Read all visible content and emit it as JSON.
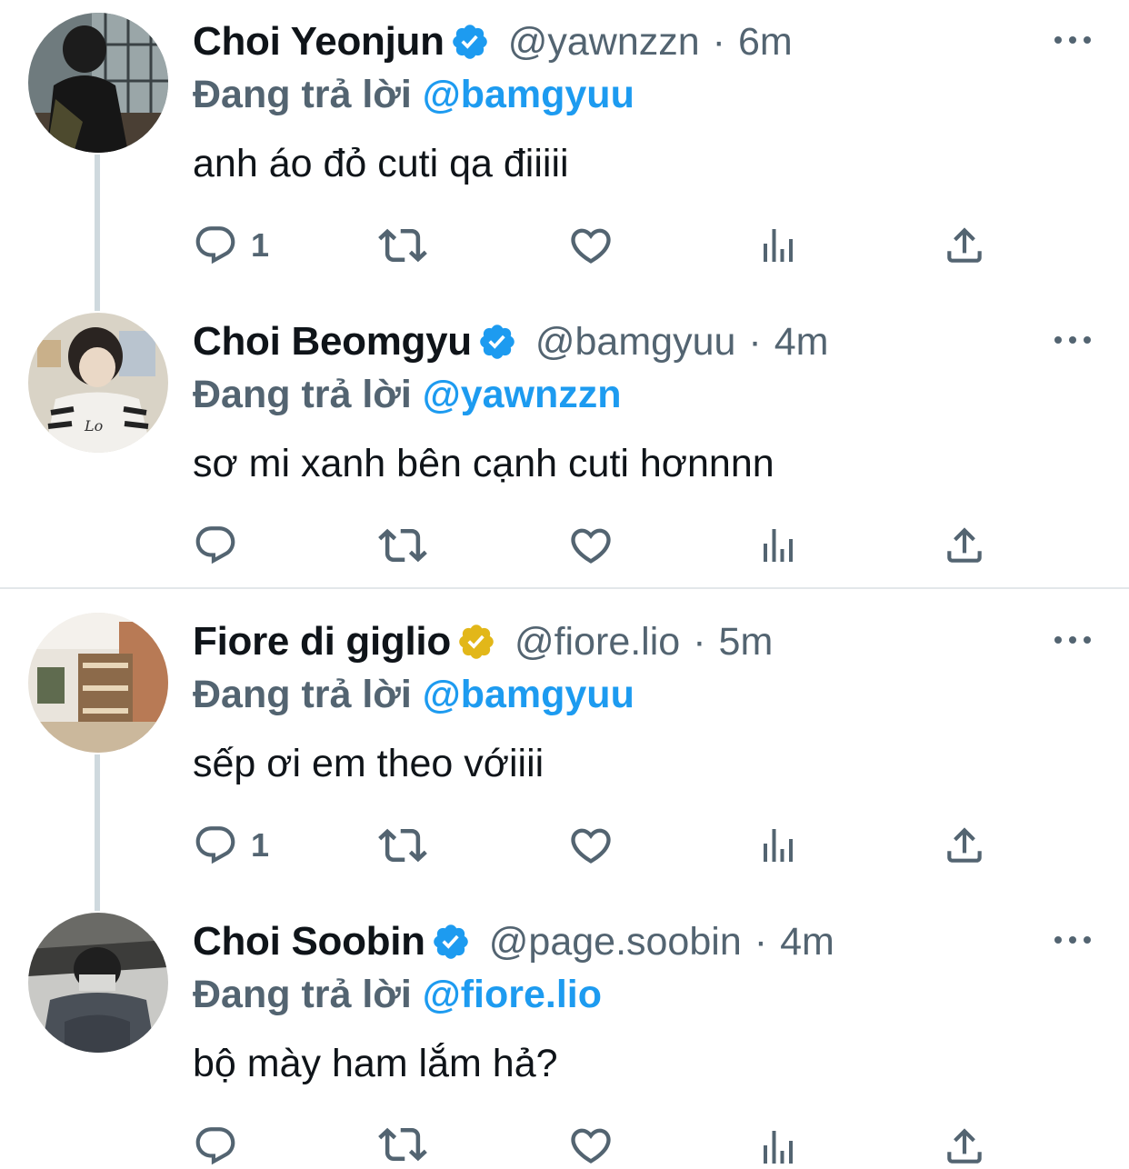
{
  "replying_label": "Đang trả lời",
  "tweets": [
    {
      "name": "Choi Yeonjun",
      "verified_color": "#1d9bf0",
      "handle": "@yawnzzn",
      "separator": "·",
      "time": "6m",
      "replying_to": "@bamgyuu",
      "text": "anh áo đỏ cuti qa điiiii",
      "reply_count": "1"
    },
    {
      "name": "Choi Beomgyu",
      "verified_color": "#1d9bf0",
      "handle": "@bamgyuu",
      "separator": "·",
      "time": "4m",
      "replying_to": "@yawnzzn",
      "text": "sơ mi xanh bên cạnh cuti hơnnnn",
      "reply_count": ""
    },
    {
      "name": "Fiore di giglio",
      "verified_color": "#e2b719",
      "handle": "@fiore.lio",
      "separator": "·",
      "time": "5m",
      "replying_to": "@bamgyuu",
      "text": "sếp ơi em theo vớiiii",
      "reply_count": "1"
    },
    {
      "name": "Choi Soobin",
      "verified_color": "#1d9bf0",
      "handle": "@page.soobin",
      "separator": "·",
      "time": "4m",
      "replying_to": "@fiore.lio",
      "text": "bộ mày ham lắm hả?",
      "reply_count": ""
    }
  ],
  "icons": [
    "reply-icon",
    "retweet-icon",
    "like-icon",
    "views-icon",
    "share-icon",
    "verified-badge-icon",
    "more-icon"
  ],
  "colors": {
    "text": "#0f1419",
    "secondary": "#536471",
    "accent": "#1d9bf0",
    "gold": "#e2b719",
    "thread_line": "#cfd9de"
  }
}
